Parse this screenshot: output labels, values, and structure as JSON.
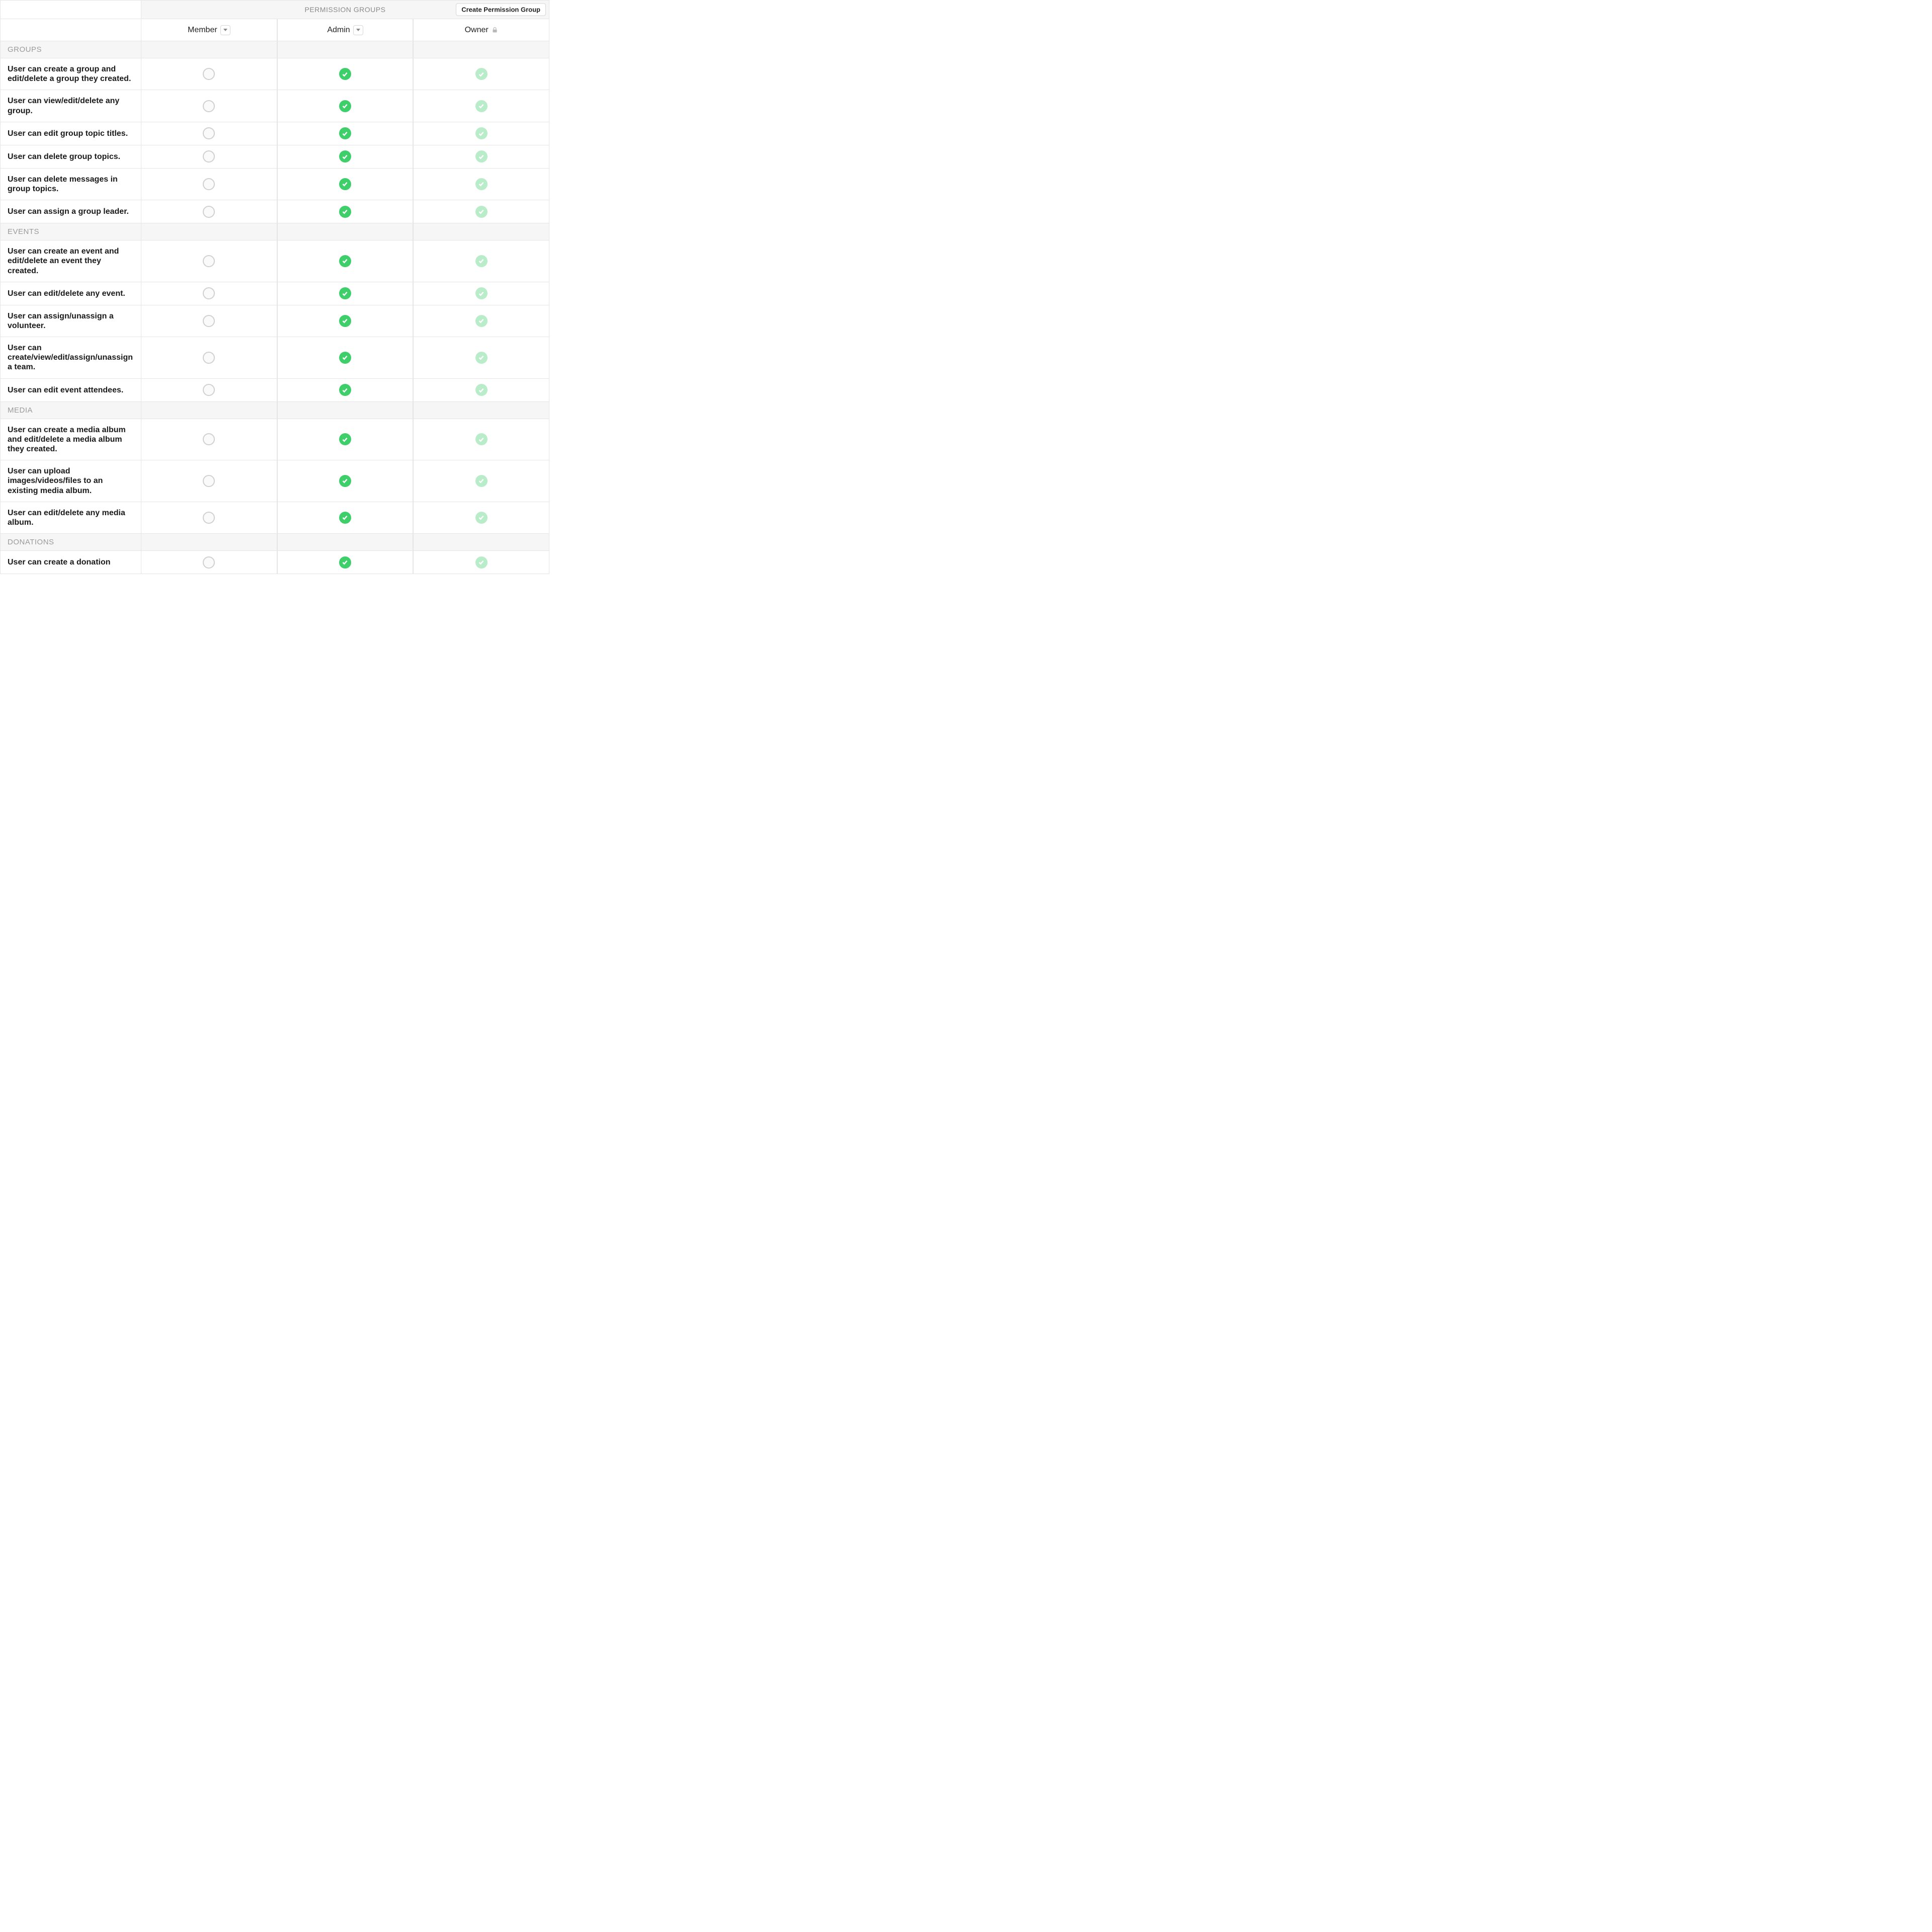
{
  "header": {
    "title": "PERMISSION GROUPS",
    "create_button": "Create Permission Group"
  },
  "columns": [
    {
      "label": "Member",
      "dropdown": true,
      "locked": false
    },
    {
      "label": "Admin",
      "dropdown": true,
      "locked": false
    },
    {
      "label": "Owner",
      "dropdown": false,
      "locked": true
    }
  ],
  "sections": [
    {
      "title": "GROUPS",
      "permissions": [
        {
          "label": "User can create a group and edit/delete a group they created.",
          "values": [
            "empty",
            "checked",
            "locked"
          ]
        },
        {
          "label": "User can view/edit/delete any group.",
          "values": [
            "empty",
            "checked",
            "locked"
          ]
        },
        {
          "label": "User can edit group topic titles.",
          "values": [
            "empty",
            "checked",
            "locked"
          ]
        },
        {
          "label": "User can delete group topics.",
          "values": [
            "empty",
            "checked",
            "locked"
          ]
        },
        {
          "label": "User can delete messages in group topics.",
          "values": [
            "empty",
            "checked",
            "locked"
          ]
        },
        {
          "label": "User can assign a group leader.",
          "values": [
            "empty",
            "checked",
            "locked"
          ]
        }
      ]
    },
    {
      "title": "EVENTS",
      "permissions": [
        {
          "label": "User can create an event and edit/delete an event they created.",
          "values": [
            "empty",
            "checked",
            "locked"
          ]
        },
        {
          "label": "User can edit/delete any event.",
          "values": [
            "empty",
            "checked",
            "locked"
          ]
        },
        {
          "label": "User can assign/unassign a volunteer.",
          "values": [
            "empty",
            "checked",
            "locked"
          ]
        },
        {
          "label": "User can create/view/edit/assign/unassign a team.",
          "values": [
            "empty",
            "checked",
            "locked"
          ]
        },
        {
          "label": "User can edit event attendees.",
          "values": [
            "empty",
            "checked",
            "locked"
          ]
        }
      ]
    },
    {
      "title": "MEDIA",
      "permissions": [
        {
          "label": "User can create a media album and edit/delete a media album they created.",
          "values": [
            "empty",
            "checked",
            "locked"
          ]
        },
        {
          "label": "User can upload images/videos/files to an existing media album.",
          "values": [
            "empty",
            "checked",
            "locked"
          ]
        },
        {
          "label": "User can edit/delete any media album.",
          "values": [
            "empty",
            "checked",
            "locked"
          ]
        }
      ]
    },
    {
      "title": "DONATIONS",
      "permissions": [
        {
          "label": "User can create a donation",
          "values": [
            "empty",
            "checked",
            "locked"
          ]
        }
      ]
    }
  ]
}
